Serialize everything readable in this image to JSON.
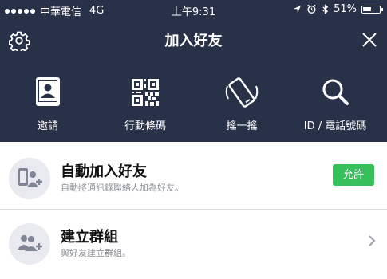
{
  "status_bar": {
    "carrier": "中華電信",
    "network": "4G",
    "time": "上午9:31",
    "battery": "51%",
    "battery_level": 0.51
  },
  "header": {
    "title": "加入好友",
    "settings_icon": "gear-icon",
    "close_icon": "close-icon"
  },
  "actions": [
    {
      "label": "邀請",
      "icon": "contact-book-icon"
    },
    {
      "label": "行動條碼",
      "icon": "qr-code-icon"
    },
    {
      "label": "搖一搖",
      "icon": "shake-phone-icon"
    },
    {
      "label": "ID / 電話號碼",
      "icon": "search-icon"
    }
  ],
  "list": [
    {
      "title": "自動加入好友",
      "subtitle": "自動將通訊錄聯絡人加為好友。",
      "button": "允許",
      "icon": "phone-add-friend-icon"
    },
    {
      "title": "建立群組",
      "subtitle": "與好友建立群組。",
      "icon": "group-add-icon"
    }
  ],
  "colors": {
    "header_bg": "#283148",
    "allow_green": "#36bf5b"
  }
}
